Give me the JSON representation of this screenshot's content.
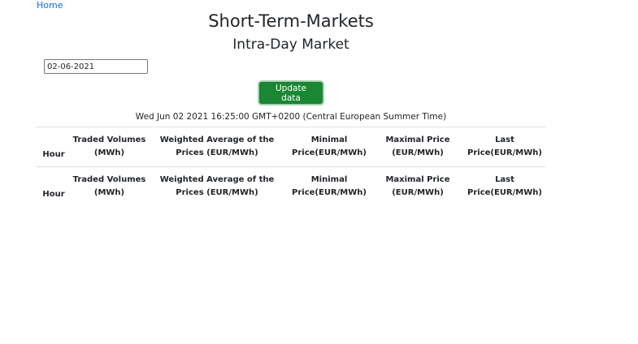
{
  "nav": {
    "home_label": "Home"
  },
  "header": {
    "title": "Short-Term-Markets",
    "subtitle": "Intra-Day Market"
  },
  "date_input": {
    "value": "02-06-2021"
  },
  "update_button": {
    "label": "Update data"
  },
  "timestamp": "Wed Jun 02 2021 16:25:00 GMT+0200 (Central European Summer Time)",
  "table": {
    "columns": [
      "Hour",
      "Traded Volumes (MWh)",
      "Weighted Average of the Prices (EUR/MWh)",
      "Minimal Price(EUR/MWh)",
      "Maximal Price (EUR/MWh)",
      "Last Price(EUR/MWh)"
    ]
  },
  "colors": {
    "link": "#0d6efd",
    "button": "#198733"
  }
}
